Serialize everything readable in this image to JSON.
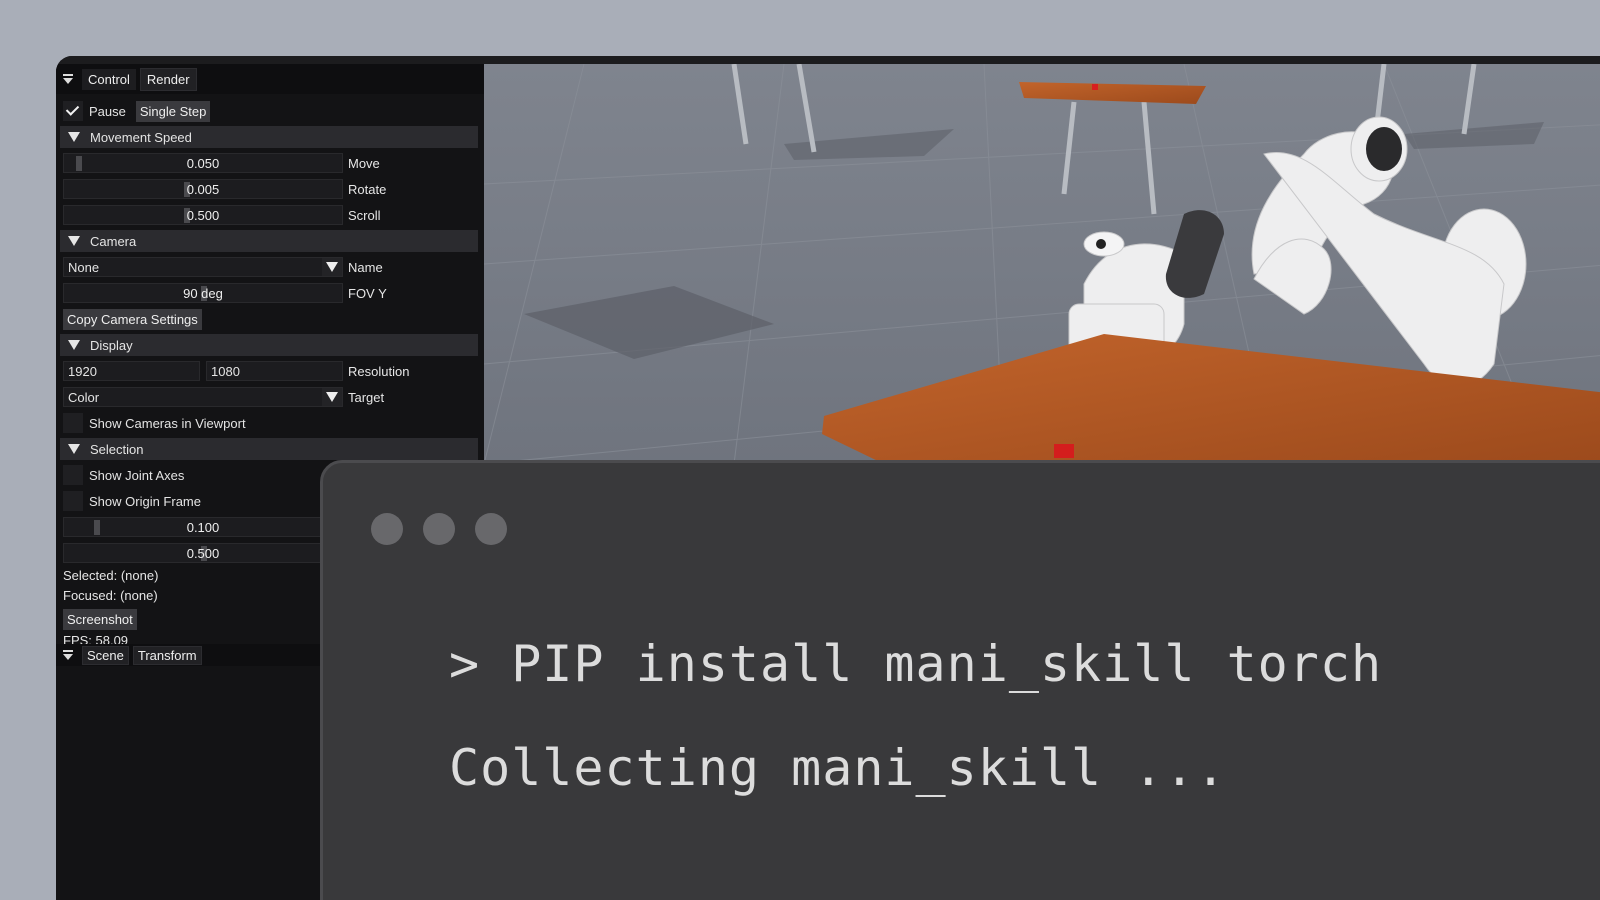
{
  "tabs_top": {
    "control": "Control",
    "render": "Render"
  },
  "control": {
    "pause_label": "Pause",
    "single_step": "Single Step",
    "movement_speed": {
      "header": "Movement Speed",
      "move": {
        "value": "0.050",
        "label": "Move"
      },
      "rotate": {
        "value": "0.005",
        "label": "Rotate"
      },
      "scroll": {
        "value": "0.500",
        "label": "Scroll"
      }
    },
    "camera": {
      "header": "Camera",
      "name_value": "None",
      "name_label": "Name",
      "fov_value": "90 deg",
      "fov_label": "FOV Y",
      "copy_button": "Copy Camera Settings"
    },
    "display": {
      "header": "Display",
      "res_w": "1920",
      "res_h": "1080",
      "res_label": "Resolution",
      "target_value": "Color",
      "target_label": "Target",
      "show_cameras": "Show Cameras in Viewport"
    },
    "selection": {
      "header": "Selection",
      "show_joint_axes": "Show Joint Axes",
      "show_origin_frame": "Show Origin Frame",
      "slider1": "0.100",
      "slider2": "0.500",
      "selected": "Selected: (none)",
      "focused": "Focused: (none)",
      "screenshot": "Screenshot",
      "fps": "FPS: 58.09"
    }
  },
  "tabs_bottom": {
    "scene": "Scene",
    "transform": "Transform"
  },
  "terminal": {
    "line1": "> PIP install mani_skill torch",
    "line2": "Collecting mani_skill ..."
  }
}
